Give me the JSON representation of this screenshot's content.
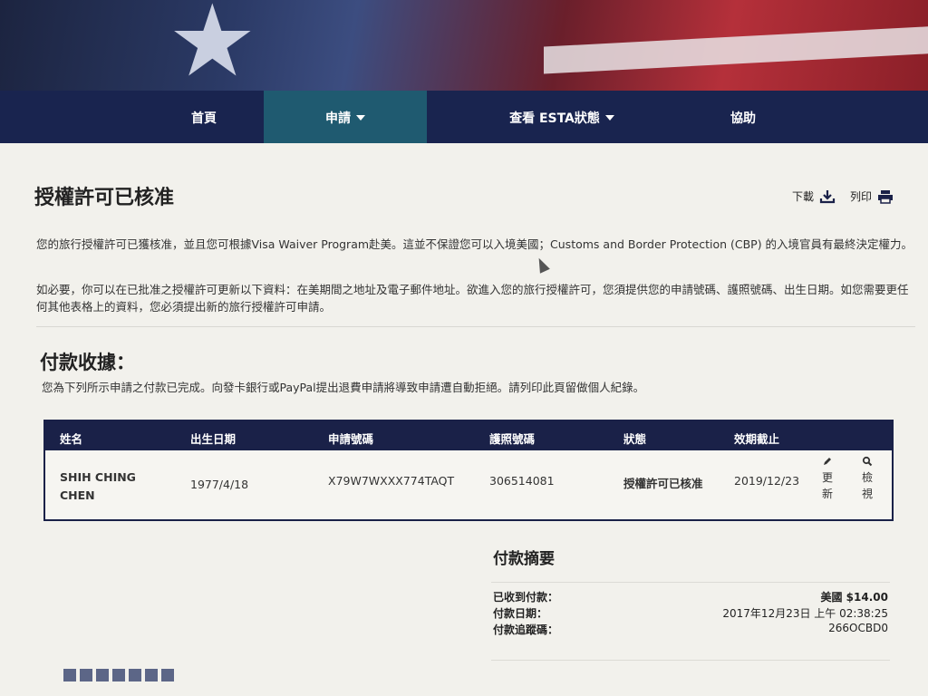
{
  "nav": {
    "items": [
      {
        "label": "首頁"
      },
      {
        "label": "申請"
      },
      {
        "label": "查看 ESTA狀態"
      },
      {
        "label": "協助"
      }
    ]
  },
  "page": {
    "title": "授權許可已核准",
    "download_label": "下載",
    "print_label": "列印",
    "para1": "您的旅行授權許可已獲核准，並且您可根據Visa Waiver Program赴美。這並不保證您可以入境美國；Customs and Border Protection (CBP) 的入境官員有最終決定權力。",
    "para2": "如必要，你可以在已批准之授權許可更新以下資料：在美期間之地址及電子郵件地址。欲進入您的旅行授權許可，您須提供您的申請號碼、護照號碼、出生日期。如您需要更任何其他表格上的資料，您必須提出新的旅行授權許可申請。"
  },
  "receipt": {
    "title": "付款收據：",
    "desc": "您為下列所示申請之付款已完成。向發卡銀行或PayPal提出退費申請將導致申請遭自動拒絕。請列印此頁留做個人紀錄。"
  },
  "table": {
    "headers": [
      "姓名",
      "出生日期",
      "申請號碼",
      "護照號碼",
      "狀態",
      "效期截止"
    ],
    "row": {
      "name": "SHIH CHING CHEN",
      "dob": "1977/4/18",
      "app_no": "X79W7WXXX774TAQT",
      "passport": "306514081",
      "status": "授權許可已核准",
      "expiry": "2019/12/23",
      "update_label": "更新",
      "view_label": "檢視"
    }
  },
  "summary": {
    "title": "付款摘要",
    "received_label": "已收到付款：",
    "received_value": "美國 $14.00",
    "date_label": "付款日期：",
    "date_value": "2017年12月23日 上午 02:38:25",
    "tracking_label": "付款追蹤碼：",
    "tracking_value": "266OCBD0"
  }
}
